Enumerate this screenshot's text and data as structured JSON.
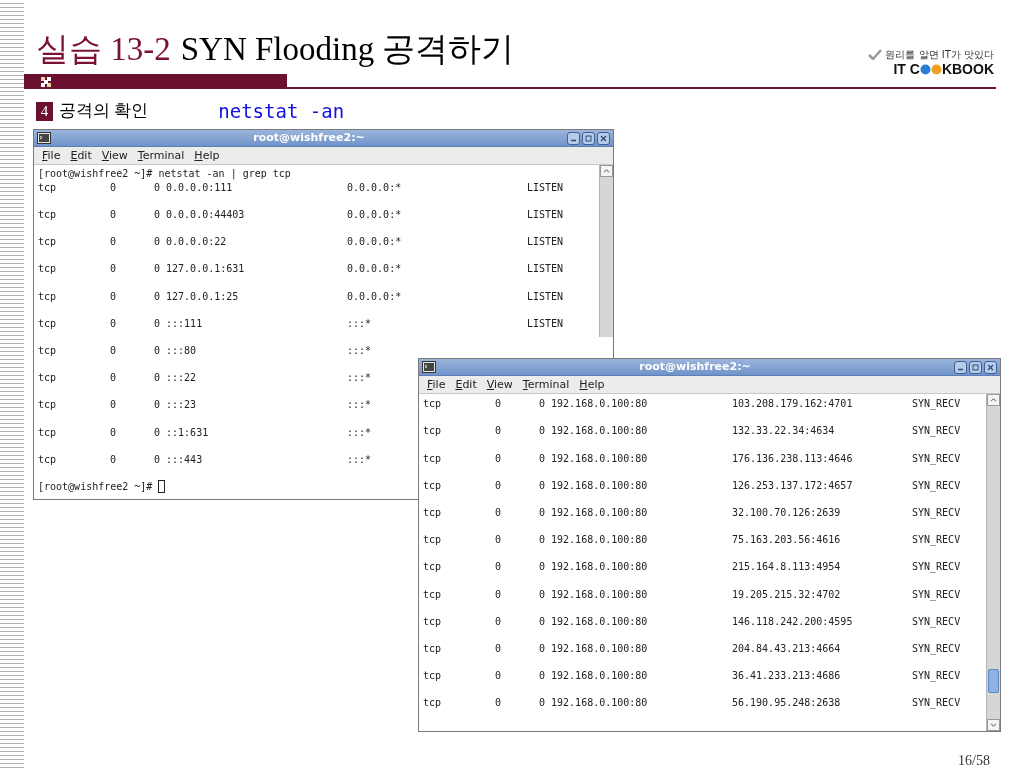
{
  "title": {
    "label": "실습 13-2",
    "text": "SYN Flooding 공격하기"
  },
  "logo": {
    "tagline": "원리를 알면 IT가 맛있다",
    "text_start": "IT C",
    "text_end": "KBOOK"
  },
  "step": {
    "number": "4",
    "label": "공격의 확인",
    "command": "netstat -an"
  },
  "windows": [
    {
      "title": "root@wishfree2:~",
      "menu": [
        "File",
        "Edit",
        "View",
        "Terminal",
        "Help"
      ],
      "lines": [
        {
          "kind": "prompt",
          "text": "[root@wishfree2 ~]# netstat -an | grep tcp",
          "cursor": false
        },
        {
          "kind": "row",
          "cells": [
            "tcp",
            "0",
            "0 0.0.0.0:111",
            "0.0.0.0:*",
            "LISTEN"
          ]
        },
        {
          "kind": "row",
          "cells": [
            "tcp",
            "0",
            "0 0.0.0.0:44403",
            "0.0.0.0:*",
            "LISTEN"
          ]
        },
        {
          "kind": "row",
          "cells": [
            "tcp",
            "0",
            "0 0.0.0.0:22",
            "0.0.0.0:*",
            "LISTEN"
          ]
        },
        {
          "kind": "row",
          "cells": [
            "tcp",
            "0",
            "0 127.0.0.1:631",
            "0.0.0.0:*",
            "LISTEN"
          ]
        },
        {
          "kind": "row",
          "cells": [
            "tcp",
            "0",
            "0 127.0.0.1:25",
            "0.0.0.0:*",
            "LISTEN"
          ]
        },
        {
          "kind": "row",
          "cells": [
            "tcp",
            "0",
            "0 :::111",
            ":::*",
            "LISTEN"
          ]
        },
        {
          "kind": "row",
          "cells": [
            "tcp",
            "0",
            "0 :::80",
            ":::*"
          ]
        },
        {
          "kind": "row",
          "cells": [
            "tcp",
            "0",
            "0 :::22",
            ":::*"
          ]
        },
        {
          "kind": "row",
          "cells": [
            "tcp",
            "0",
            "0 :::23",
            ":::*"
          ]
        },
        {
          "kind": "row",
          "cells": [
            "tcp",
            "0",
            "0 ::1:631",
            ":::*"
          ]
        },
        {
          "kind": "row",
          "cells": [
            "tcp",
            "0",
            "0 :::443",
            ":::*"
          ]
        },
        {
          "kind": "prompt",
          "text": "[root@wishfree2 ~]#",
          "cursor": true
        }
      ]
    },
    {
      "title": "root@wishfree2:~",
      "menu": [
        "File",
        "Edit",
        "View",
        "Terminal",
        "Help"
      ],
      "lines": [
        {
          "kind": "row",
          "cells": [
            "tcp",
            "0",
            "0 192.168.0.100:80",
            "103.208.179.162:4701",
            "SYN_RECV"
          ]
        },
        {
          "kind": "row",
          "cells": [
            "tcp",
            "0",
            "0 192.168.0.100:80",
            "132.33.22.34:4634",
            "SYN_RECV"
          ]
        },
        {
          "kind": "row",
          "cells": [
            "tcp",
            "0",
            "0 192.168.0.100:80",
            "176.136.238.113:4646",
            "SYN_RECV"
          ]
        },
        {
          "kind": "row",
          "cells": [
            "tcp",
            "0",
            "0 192.168.0.100:80",
            "126.253.137.172:4657",
            "SYN_RECV"
          ]
        },
        {
          "kind": "row",
          "cells": [
            "tcp",
            "0",
            "0 192.168.0.100:80",
            "32.100.70.126:2639",
            "SYN_RECV"
          ]
        },
        {
          "kind": "row",
          "cells": [
            "tcp",
            "0",
            "0 192.168.0.100:80",
            "75.163.203.56:4616",
            "SYN_RECV"
          ]
        },
        {
          "kind": "row",
          "cells": [
            "tcp",
            "0",
            "0 192.168.0.100:80",
            "215.164.8.113:4954",
            "SYN_RECV"
          ]
        },
        {
          "kind": "row",
          "cells": [
            "tcp",
            "0",
            "0 192.168.0.100:80",
            "19.205.215.32:4702",
            "SYN_RECV"
          ]
        },
        {
          "kind": "row",
          "cells": [
            "tcp",
            "0",
            "0 192.168.0.100:80",
            "146.118.242.200:4595",
            "SYN_RECV"
          ]
        },
        {
          "kind": "row",
          "cells": [
            "tcp",
            "0",
            "0 192.168.0.100:80",
            "204.84.43.213:4664",
            "SYN_RECV"
          ]
        },
        {
          "kind": "row",
          "cells": [
            "tcp",
            "0",
            "0 192.168.0.100:80",
            "36.41.233.213:4686",
            "SYN_RECV"
          ]
        },
        {
          "kind": "row",
          "cells": [
            "tcp",
            "0",
            "0 192.168.0.100:80",
            "56.190.95.248:2638",
            "SYN_RECV"
          ]
        }
      ]
    }
  ],
  "page": "16/58"
}
